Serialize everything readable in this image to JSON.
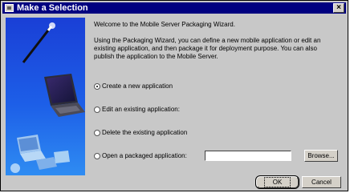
{
  "window": {
    "title": "Make a Selection",
    "close_glyph": "×"
  },
  "content": {
    "welcome": "Welcome to the Mobile Server Packaging Wizard.",
    "description": "Using the Packaging Wizard, you can define a new mobile application or edit an existing application, and then package it for deployment purpose.  You can also publish the application to the Mobile Server."
  },
  "options": [
    {
      "label": "Create a new application",
      "checked": true
    },
    {
      "label": "Edit an existing application:",
      "checked": false
    },
    {
      "label": "Delete the existing application",
      "checked": false
    },
    {
      "label": "Open a packaged application:",
      "checked": false
    }
  ],
  "path_input": {
    "value": ""
  },
  "buttons": {
    "browse": "Browse...",
    "ok": "OK",
    "cancel": "Cancel"
  },
  "colors": {
    "titlebar": "#000080",
    "dialog_bg": "#c8c8c8"
  }
}
